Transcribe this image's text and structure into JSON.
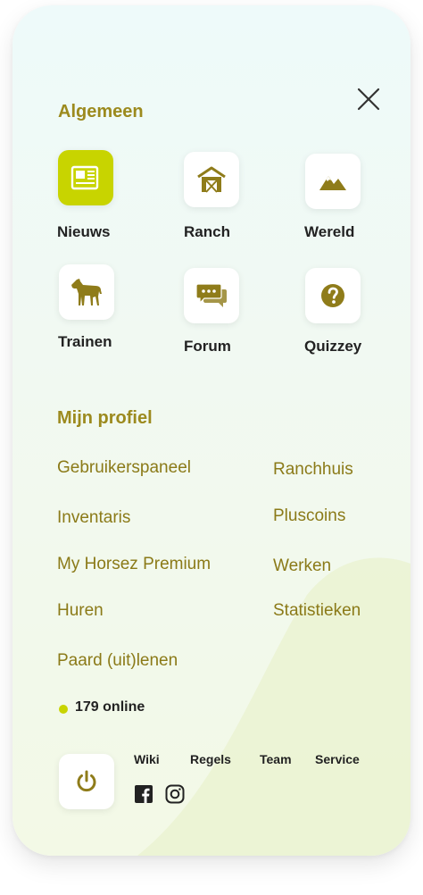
{
  "colors": {
    "accent": "#c8d400",
    "brand_text": "#9c8a1e",
    "link_text": "#8b7a18",
    "icon": "#8f7c1a"
  },
  "sections": {
    "general_title": "Algemeen",
    "profile_title": "Mijn profiel"
  },
  "tiles": [
    {
      "label": "Nieuws",
      "icon": "newspaper-icon"
    },
    {
      "label": "Ranch",
      "icon": "barn-icon"
    },
    {
      "label": "Wereld",
      "icon": "mountains-icon"
    },
    {
      "label": "Trainen",
      "icon": "horse-icon"
    },
    {
      "label": "Forum",
      "icon": "chat-bubbles-icon"
    },
    {
      "label": "Quizzey",
      "icon": "question-icon"
    }
  ],
  "profile_links": [
    "Gebruikerspaneel",
    "Ranchhuis",
    "Inventaris",
    "Pluscoins",
    "My Horsez Premium",
    "Werken",
    "Huren",
    "Statistieken",
    "Paard (uit)lenen"
  ],
  "online": {
    "text": "179 online"
  },
  "footer": {
    "links": [
      "Wiki",
      "Regels",
      "Team",
      "Service"
    ],
    "social": [
      "facebook-icon",
      "instagram-icon"
    ]
  }
}
